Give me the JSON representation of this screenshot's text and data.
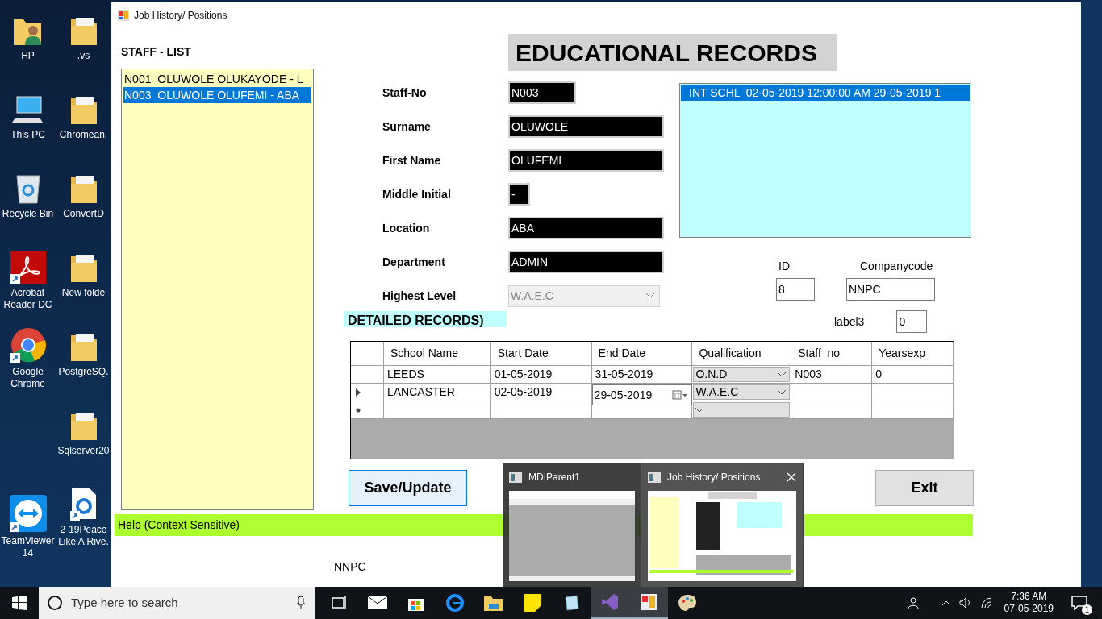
{
  "desktop": {
    "columns": [
      {
        "icons": [
          {
            "label": "HP",
            "kind": "user-folder",
            "shortcut": false
          },
          {
            "label": "This PC",
            "kind": "computer",
            "shortcut": false
          },
          {
            "label": "Recycle Bin",
            "kind": "recycle-bin",
            "shortcut": false
          },
          {
            "label": "Acrobat Reader DC",
            "kind": "pdf",
            "shortcut": true
          },
          {
            "label": "Google Chrome",
            "kind": "chrome",
            "shortcut": true
          },
          {
            "label": "TeamViewer 14",
            "kind": "teamviewer",
            "shortcut": true
          }
        ]
      },
      {
        "icons": [
          {
            "label": ".vs",
            "kind": "folder",
            "shortcut": false
          },
          {
            "label": "Chromean.",
            "kind": "folder",
            "shortcut": false
          },
          {
            "label": "ConvertD",
            "kind": "folder",
            "shortcut": false
          },
          {
            "label": "New folde",
            "kind": "folder",
            "shortcut": false
          },
          {
            "label": "PostgreSQ.",
            "kind": "folder",
            "shortcut": false
          },
          {
            "label": "Sqlserver20",
            "kind": "folder",
            "shortcut": false
          },
          {
            "label": "2-19Peace Like A Rive.",
            "kind": "document",
            "shortcut": true
          }
        ]
      }
    ]
  },
  "window": {
    "title": "Job History/ Positions"
  },
  "staff_list": {
    "label": "STAFF - LIST",
    "items": [
      {
        "text": "N001  OLUWOLE OLUKAYODE - L",
        "selected": false
      },
      {
        "text": "N003  OLUWOLE OLUFEMI - ABA",
        "selected": true
      }
    ]
  },
  "form": {
    "title": "EDUCATIONAL RECORDS",
    "fields": [
      {
        "label": "Staff-No",
        "value": "N003",
        "kind": "code"
      },
      {
        "label": "Surname",
        "value": "OLUWOLE",
        "kind": "text"
      },
      {
        "label": "First Name",
        "value": "OLUFEMI",
        "kind": "text"
      },
      {
        "label": "Middle Initial",
        "value": "-",
        "kind": "initial"
      },
      {
        "label": "Location",
        "value": "ABA",
        "kind": "text"
      },
      {
        "label": "Department",
        "value": "ADMIN",
        "kind": "text"
      },
      {
        "label": "Highest Level",
        "value": "W.A.E.C",
        "kind": "combo",
        "disabled": true
      }
    ]
  },
  "records_list": {
    "items": [
      {
        "text": "INT SCHL  02-05-2019 12:00:00 AM 29-05-2019 1",
        "selected": true
      }
    ]
  },
  "id": {
    "label": "ID",
    "value": "8"
  },
  "company_code": {
    "label": "Companycode",
    "value": "NNPC"
  },
  "label3": {
    "label": "label3",
    "value": "0"
  },
  "detailed_records": {
    "title": "DETAILED RECORDS)",
    "columns": [
      {
        "label": "School Name",
        "kind": "text"
      },
      {
        "label": "Start Date",
        "kind": "text"
      },
      {
        "label": "End Date",
        "kind": "date"
      },
      {
        "label": "Qualification",
        "kind": "combo"
      },
      {
        "label": "Staff_no",
        "kind": "text"
      },
      {
        "label": "Yearsexp",
        "kind": "text"
      }
    ],
    "rows": [
      {
        "kind": "data",
        "current": false,
        "editing": false,
        "cells": [
          "LEEDS",
          "01-05-2019",
          "31-05-2019",
          "O.N.D",
          "N003",
          "0"
        ]
      },
      {
        "kind": "data",
        "current": true,
        "editing": true,
        "cells": [
          "LANCASTER",
          "02-05-2019",
          "29-05-2019",
          "W.A.E.C"
        ]
      },
      {
        "kind": "new",
        "current": false,
        "editing": false,
        "cells": []
      }
    ]
  },
  "buttons": [
    {
      "label": "Save/Update",
      "focused": true
    },
    {
      "label": "Exit",
      "focused": false
    }
  ],
  "help_bar": "Help (Context Sensitive)",
  "footer_text": "NNPC",
  "taskbar_preview": {
    "windows": [
      {
        "title": "MDIParent1",
        "hovered": false
      },
      {
        "title": "Job History/ Positions",
        "hovered": true
      }
    ]
  },
  "taskbar": {
    "search_placeholder": "Type here to search",
    "apps": [
      {
        "kind": "task-view",
        "active": false
      },
      {
        "kind": "mail",
        "active": false
      },
      {
        "kind": "store",
        "active": false
      },
      {
        "kind": "edge",
        "active": false
      },
      {
        "kind": "explorer",
        "active": false
      },
      {
        "kind": "sticky-notes",
        "active": false
      },
      {
        "kind": "notepad",
        "active": false
      },
      {
        "kind": "visual-studio",
        "active": true
      },
      {
        "kind": "form-app",
        "active": true
      },
      {
        "kind": "paint",
        "active": false
      }
    ],
    "time": "7:36 AM",
    "date": "07-05-2019",
    "notifications": "1"
  }
}
